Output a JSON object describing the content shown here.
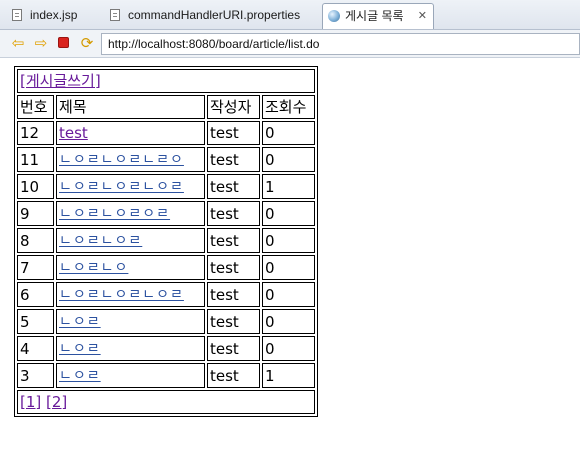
{
  "tabs": [
    {
      "label": "index.jsp",
      "icon": "file-icon",
      "active": false
    },
    {
      "label": "commandHandlerURI.properties",
      "icon": "file-icon",
      "active": false
    },
    {
      "label": "게시글 목록",
      "icon": "globe-icon",
      "active": true
    }
  ],
  "toolbar": {
    "url": "http://localhost:8080/board/article/list.do",
    "buttons": [
      "back-icon",
      "forward-icon",
      "stop-icon",
      "refresh-icon"
    ]
  },
  "board": {
    "write_link": "[게시글쓰기]",
    "headers": {
      "no": "번호",
      "title": "제목",
      "author": "작성자",
      "views": "조회수"
    },
    "rows": [
      {
        "no": "12",
        "title": "test",
        "author": "test",
        "views": "0"
      },
      {
        "no": "11",
        "title": "ㄴㅇㄹㄴㅇㄹㄴㄹㅇ",
        "author": "test",
        "views": "0"
      },
      {
        "no": "10",
        "title": "ㄴㅇㄹㄴㅇㄹㄴㅇㄹ",
        "author": "test",
        "views": "1"
      },
      {
        "no": "9",
        "title": "ㄴㅇㄹㄴㅇㄹㅇㄹ",
        "author": "test",
        "views": "0"
      },
      {
        "no": "8",
        "title": "ㄴㅇㄹㄴㅇㄹ",
        "author": "test",
        "views": "0"
      },
      {
        "no": "7",
        "title": "ㄴㅇㄹㄴㅇ",
        "author": "test",
        "views": "0"
      },
      {
        "no": "6",
        "title": "ㄴㅇㄹㄴㅇㄹㄴㅇㄹ",
        "author": "test",
        "views": "0"
      },
      {
        "no": "5",
        "title": "ㄴㅇㄹ",
        "author": "test",
        "views": "0"
      },
      {
        "no": "4",
        "title": "ㄴㅇㄹ",
        "author": "test",
        "views": "0"
      },
      {
        "no": "3",
        "title": "ㄴㅇㄹ",
        "author": "test",
        "views": "1"
      }
    ],
    "pages": [
      "[1]",
      "[2]"
    ]
  }
}
